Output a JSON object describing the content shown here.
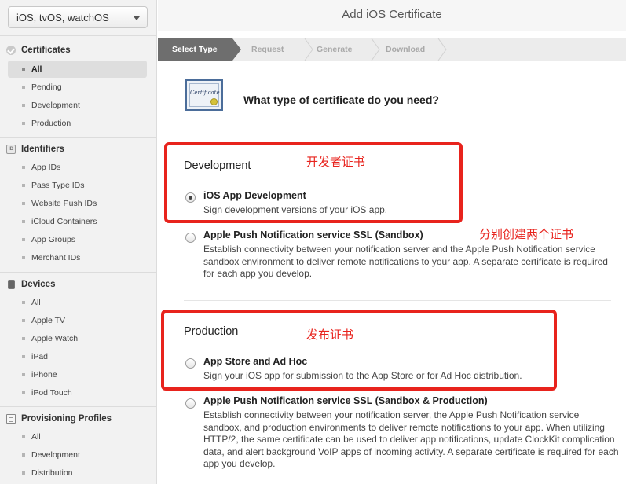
{
  "sidebar": {
    "platform": "iOS, tvOS, watchOS",
    "sections": [
      {
        "title": "Certificates",
        "icon": "check-circle-icon",
        "items": [
          "All",
          "Pending",
          "Development",
          "Production"
        ]
      },
      {
        "title": "Identifiers",
        "icon": "id-card-icon",
        "items": [
          "App IDs",
          "Pass Type IDs",
          "Website Push IDs",
          "iCloud Containers",
          "App Groups",
          "Merchant IDs"
        ]
      },
      {
        "title": "Devices",
        "icon": "device-icon",
        "items": [
          "All",
          "Apple TV",
          "Apple Watch",
          "iPad",
          "iPhone",
          "iPod Touch"
        ]
      },
      {
        "title": "Provisioning Profiles",
        "icon": "document-icon",
        "items": [
          "All",
          "Development",
          "Distribution"
        ]
      }
    ],
    "active_item": "Certificates/All"
  },
  "header": {
    "title": "Add iOS Certificate"
  },
  "steps": [
    "Select Type",
    "Request",
    "Generate",
    "Download"
  ],
  "question": "What type of certificate do you need?",
  "development": {
    "title": "Development",
    "options": [
      {
        "title": "iOS App Development",
        "desc": "Sign development versions of your iOS app.",
        "selected": true
      },
      {
        "title": "Apple Push Notification service SSL (Sandbox)",
        "desc": "Establish connectivity between your notification server and the Apple Push Notification service sandbox environment to deliver remote notifications to your app. A separate certificate is required for each app you develop.",
        "selected": false
      }
    ]
  },
  "production": {
    "title": "Production",
    "options": [
      {
        "title": "App Store and Ad Hoc",
        "desc": "Sign your iOS app for submission to the App Store or for Ad Hoc distribution.",
        "selected": false
      },
      {
        "title": "Apple Push Notification service SSL (Sandbox & Production)",
        "desc": "Establish connectivity between your notification server, the Apple Push Notification service sandbox, and production environments to deliver remote notifications to your app. When utilizing HTTP/2, the same certificate can be used to deliver app notifications, update ClockKit complication data, and alert background VoIP apps of incoming activity. A separate certificate is required for each app you develop.",
        "selected": false
      }
    ]
  },
  "annotations": {
    "dev_note": "开发者证书",
    "split_note": "分别创建两个证书",
    "prod_note": "发布证书",
    "color": "#e8231d"
  }
}
